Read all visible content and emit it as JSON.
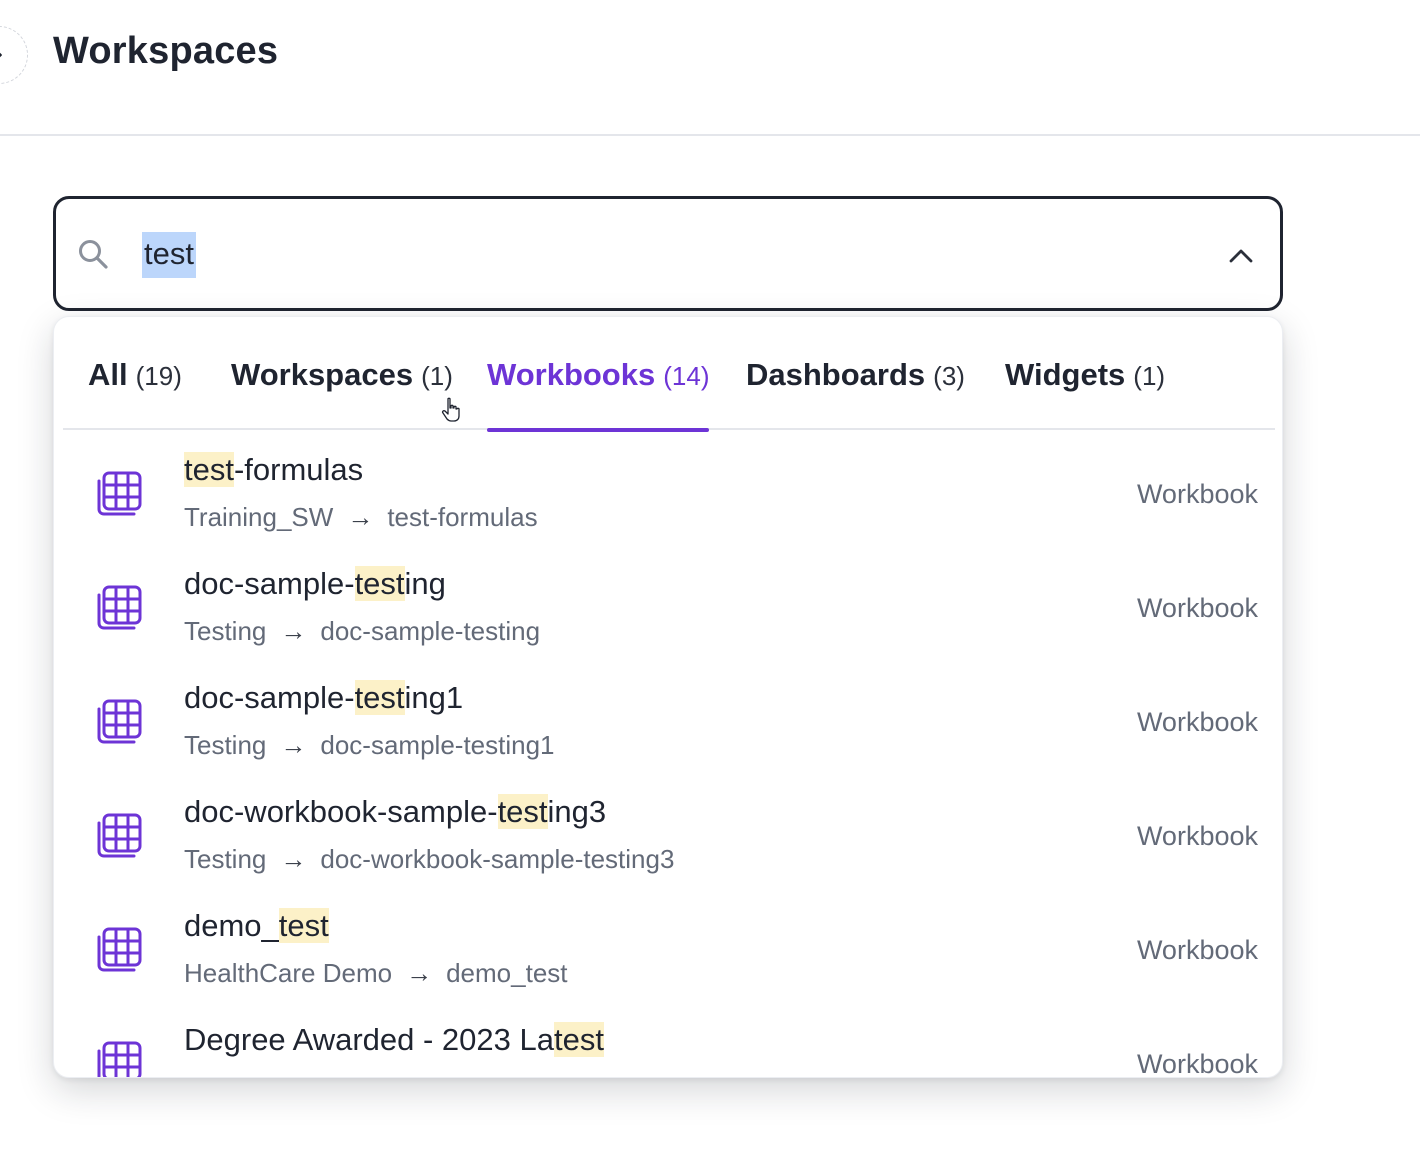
{
  "header": {
    "title": "Workspaces"
  },
  "search": {
    "value": "test",
    "placeholder": ""
  },
  "tabs": [
    {
      "label": "All",
      "count": "(19)"
    },
    {
      "label": "Workspaces",
      "count": "(1)"
    },
    {
      "label": "Workbooks",
      "count": "(14)"
    },
    {
      "label": "Dashboards",
      "count": "(3)"
    },
    {
      "label": "Widgets",
      "count": "(1)"
    }
  ],
  "active_tab": "Workbooks",
  "colors": {
    "accent": "#6d34d6",
    "highlight": "#fcf1c8",
    "selection": "#bcd6fb"
  },
  "results": [
    {
      "title_pre": "",
      "title_match": "test",
      "title_post": "-formulas",
      "path_parent": "Training_SW",
      "path_arrow": "→",
      "path_item": "test-formulas",
      "type": "Workbook",
      "icon": "workbook-grid-icon"
    },
    {
      "title_pre": "doc-sample-",
      "title_match": "test",
      "title_post": "ing",
      "path_parent": "Testing",
      "path_arrow": "→",
      "path_item": "doc-sample-testing",
      "type": "Workbook",
      "icon": "workbook-grid-icon"
    },
    {
      "title_pre": "doc-sample-",
      "title_match": "test",
      "title_post": "ing1",
      "path_parent": "Testing",
      "path_arrow": "→",
      "path_item": "doc-sample-testing1",
      "type": "Workbook",
      "icon": "workbook-grid-icon"
    },
    {
      "title_pre": "doc-workbook-sample-",
      "title_match": "test",
      "title_post": "ing3",
      "path_parent": "Testing",
      "path_arrow": "→",
      "path_item": "doc-workbook-sample-testing3",
      "type": "Workbook",
      "icon": "workbook-grid-icon"
    },
    {
      "title_pre": "demo_",
      "title_match": "test",
      "title_post": "",
      "path_parent": "HealthCare Demo",
      "path_arrow": "→",
      "path_item": "demo_test",
      "type": "Workbook",
      "icon": "workbook-grid-icon"
    },
    {
      "title_pre": "Degree Awarded - 2023 La",
      "title_match": "test",
      "title_post": "",
      "path_parent": "",
      "path_arrow": "",
      "path_item": "",
      "type": "Workbook",
      "icon": "workbook-grid-icon"
    }
  ]
}
